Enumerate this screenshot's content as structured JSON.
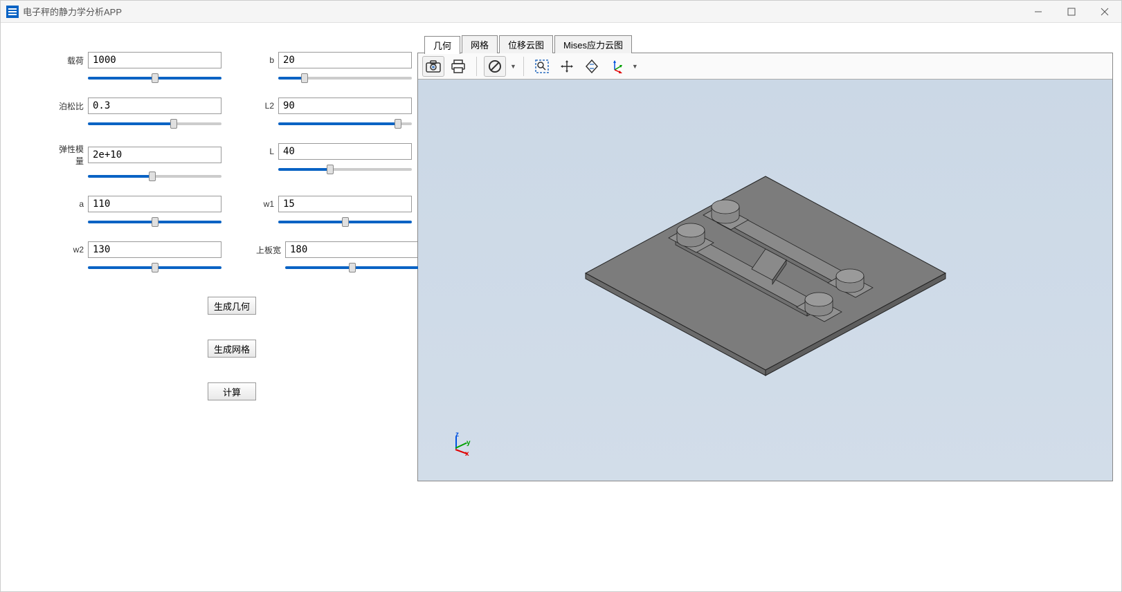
{
  "window": {
    "title": "电子秤的静力学分析APP"
  },
  "params": {
    "col1": [
      {
        "label": "载荷",
        "value": "1000",
        "fill": 100
      },
      {
        "label": "泊松比",
        "value": "0.3",
        "fill": 65
      },
      {
        "label": "弹性模量",
        "value": "2e+10",
        "fill": 48
      },
      {
        "label": "a",
        "value": "110",
        "fill": 100
      },
      {
        "label": "w2",
        "value": "130",
        "fill": 100
      }
    ],
    "col2": [
      {
        "label": "b",
        "value": "20",
        "fill": 18
      },
      {
        "label": "L2",
        "value": "90",
        "fill": 92
      },
      {
        "label": "L",
        "value": "40",
        "fill": 38
      },
      {
        "label": "w1",
        "value": "15",
        "fill": 100
      },
      {
        "label": "上板宽",
        "value": "180",
        "fill": 100,
        "wide": true
      }
    ]
  },
  "actions": {
    "gen_geom": "生成几何",
    "gen_mesh": "生成网格",
    "compute": "计算"
  },
  "tabs": {
    "geom": "几何",
    "mesh": "网格",
    "disp": "位移云图",
    "mises": "Mises应力云图",
    "active": "geom"
  },
  "toolbar": {
    "screenshot": "camera-icon",
    "print": "print-icon",
    "no_entry": "forbid-icon",
    "zoom_box": "zoom-box-icon",
    "pan": "pan-icon",
    "home_view": "rotate-icon",
    "axes": "axes-icon"
  },
  "axis_labels": {
    "x": "x",
    "y": "y",
    "z": "z"
  }
}
